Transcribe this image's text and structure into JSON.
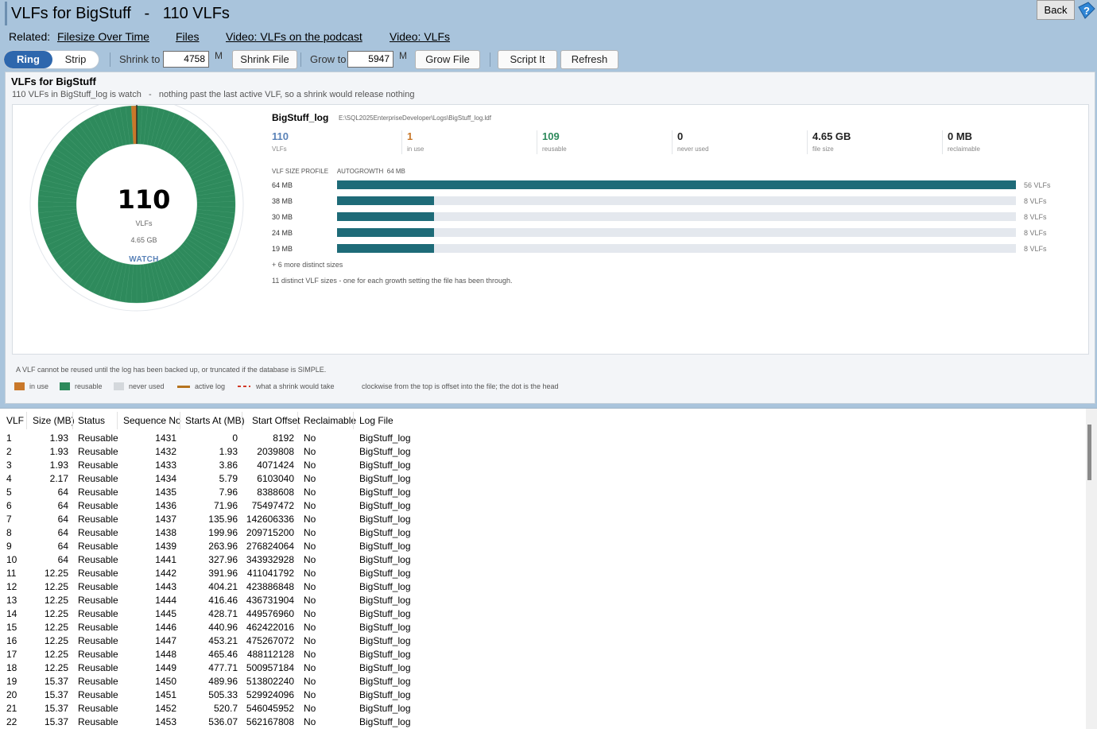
{
  "window": {
    "title": "VLFs for BigStuff   -   110 VLFs",
    "back_label": "Back"
  },
  "related": {
    "label": "Related:",
    "links": [
      "Filesize Over Time",
      "Files",
      "Video: VLFs on the podcast",
      "Video: VLFs"
    ]
  },
  "toolbar": {
    "view_ring": "Ring",
    "view_strip": "Strip",
    "shrink_label": "Shrink to",
    "shrink_value": "4758",
    "shrink_unit": "M",
    "shrink_button": "Shrink File",
    "grow_label": "Grow to",
    "grow_value": "5947",
    "grow_unit": "M",
    "grow_button": "Grow File",
    "script_button": "Script It",
    "refresh_button": "Refresh"
  },
  "panel": {
    "title": "VLFs for BigStuff",
    "subtitle": "110 VLFs in BigStuff_log is watch   -   nothing past the last active VLF, so a shrink would release nothing",
    "ring": {
      "total": "110",
      "unit": "VLFs",
      "size": "4.65 GB",
      "state": "WATCH",
      "in_use": 1,
      "reusable": 109,
      "never_used": 0,
      "active_position": 0.009
    },
    "log_name": "BigStuff_log",
    "log_path": "E:\\SQL2025EnterpriseDeveloper\\Logs\\BigStuff_log.ldf",
    "stats": [
      {
        "value": "110",
        "label": "VLFs",
        "color": "#5b83b8"
      },
      {
        "value": "1",
        "label": "in use",
        "color": "#c9782a"
      },
      {
        "value": "109",
        "label": "reusable",
        "color": "#2e8a5c"
      },
      {
        "value": "0",
        "label": "never used",
        "color": "#222222"
      },
      {
        "value": "4.65 GB",
        "label": "file size",
        "color": "#222222"
      },
      {
        "value": "0 MB",
        "label": "reclaimable",
        "color": "#222222"
      }
    ],
    "profile": {
      "heading": "VLF SIZE PROFILE",
      "autogrowth": "AUTOGROWTH  64 MB",
      "rows": [
        {
          "size": "64 MB",
          "count": "56 VLFs",
          "share": 1.0
        },
        {
          "size": "38 MB",
          "count": "8 VLFs",
          "share": 0.143
        },
        {
          "size": "30 MB",
          "count": "8 VLFs",
          "share": 0.143
        },
        {
          "size": "24 MB",
          "count": "8 VLFs",
          "share": 0.143
        },
        {
          "size": "19 MB",
          "count": "8 VLFs",
          "share": 0.143
        }
      ],
      "more": "+ 6 more distinct sizes",
      "note": "11 distinct VLF sizes - one for each growth setting the file has been through."
    },
    "footnote": "A VLF cannot be reused until the log has been backed up, or truncated if the database is SIMPLE.",
    "legend": {
      "in_use": "in use",
      "reusable": "reusable",
      "never_used": "never used",
      "active_log": "active log",
      "shrink": "what a shrink would take",
      "note": "clockwise from the top is offset into the file; the dot is the head"
    },
    "colors": {
      "in_use": "#c9782a",
      "reusable": "#2e8a5c",
      "never_used": "#d4d8dc",
      "active_log": "#b5741f",
      "shrink": "#d23a2a",
      "bar": "#1e6b78"
    }
  },
  "table": {
    "columns": [
      "VLF",
      "Size (MB)",
      "Status",
      "Sequence No",
      "Starts At (MB)",
      "Start Offset",
      "Reclaimable",
      "Log File"
    ],
    "rows": [
      [
        "1",
        "1.93",
        "Reusable",
        "1431",
        "0",
        "8192",
        "No",
        "BigStuff_log"
      ],
      [
        "2",
        "1.93",
        "Reusable",
        "1432",
        "1.93",
        "2039808",
        "No",
        "BigStuff_log"
      ],
      [
        "3",
        "1.93",
        "Reusable",
        "1433",
        "3.86",
        "4071424",
        "No",
        "BigStuff_log"
      ],
      [
        "4",
        "2.17",
        "Reusable",
        "1434",
        "5.79",
        "6103040",
        "No",
        "BigStuff_log"
      ],
      [
        "5",
        "64",
        "Reusable",
        "1435",
        "7.96",
        "8388608",
        "No",
        "BigStuff_log"
      ],
      [
        "6",
        "64",
        "Reusable",
        "1436",
        "71.96",
        "75497472",
        "No",
        "BigStuff_log"
      ],
      [
        "7",
        "64",
        "Reusable",
        "1437",
        "135.96",
        "142606336",
        "No",
        "BigStuff_log"
      ],
      [
        "8",
        "64",
        "Reusable",
        "1438",
        "199.96",
        "209715200",
        "No",
        "BigStuff_log"
      ],
      [
        "9",
        "64",
        "Reusable",
        "1439",
        "263.96",
        "276824064",
        "No",
        "BigStuff_log"
      ],
      [
        "10",
        "64",
        "Reusable",
        "1441",
        "327.96",
        "343932928",
        "No",
        "BigStuff_log"
      ],
      [
        "11",
        "12.25",
        "Reusable",
        "1442",
        "391.96",
        "411041792",
        "No",
        "BigStuff_log"
      ],
      [
        "12",
        "12.25",
        "Reusable",
        "1443",
        "404.21",
        "423886848",
        "No",
        "BigStuff_log"
      ],
      [
        "13",
        "12.25",
        "Reusable",
        "1444",
        "416.46",
        "436731904",
        "No",
        "BigStuff_log"
      ],
      [
        "14",
        "12.25",
        "Reusable",
        "1445",
        "428.71",
        "449576960",
        "No",
        "BigStuff_log"
      ],
      [
        "15",
        "12.25",
        "Reusable",
        "1446",
        "440.96",
        "462422016",
        "No",
        "BigStuff_log"
      ],
      [
        "16",
        "12.25",
        "Reusable",
        "1447",
        "453.21",
        "475267072",
        "No",
        "BigStuff_log"
      ],
      [
        "17",
        "12.25",
        "Reusable",
        "1448",
        "465.46",
        "488112128",
        "No",
        "BigStuff_log"
      ],
      [
        "18",
        "12.25",
        "Reusable",
        "1449",
        "477.71",
        "500957184",
        "No",
        "BigStuff_log"
      ],
      [
        "19",
        "15.37",
        "Reusable",
        "1450",
        "489.96",
        "513802240",
        "No",
        "BigStuff_log"
      ],
      [
        "20",
        "15.37",
        "Reusable",
        "1451",
        "505.33",
        "529924096",
        "No",
        "BigStuff_log"
      ],
      [
        "21",
        "15.37",
        "Reusable",
        "1452",
        "520.7",
        "546045952",
        "No",
        "BigStuff_log"
      ],
      [
        "22",
        "15.37",
        "Reusable",
        "1453",
        "536.07",
        "562167808",
        "No",
        "BigStuff_log"
      ]
    ]
  }
}
